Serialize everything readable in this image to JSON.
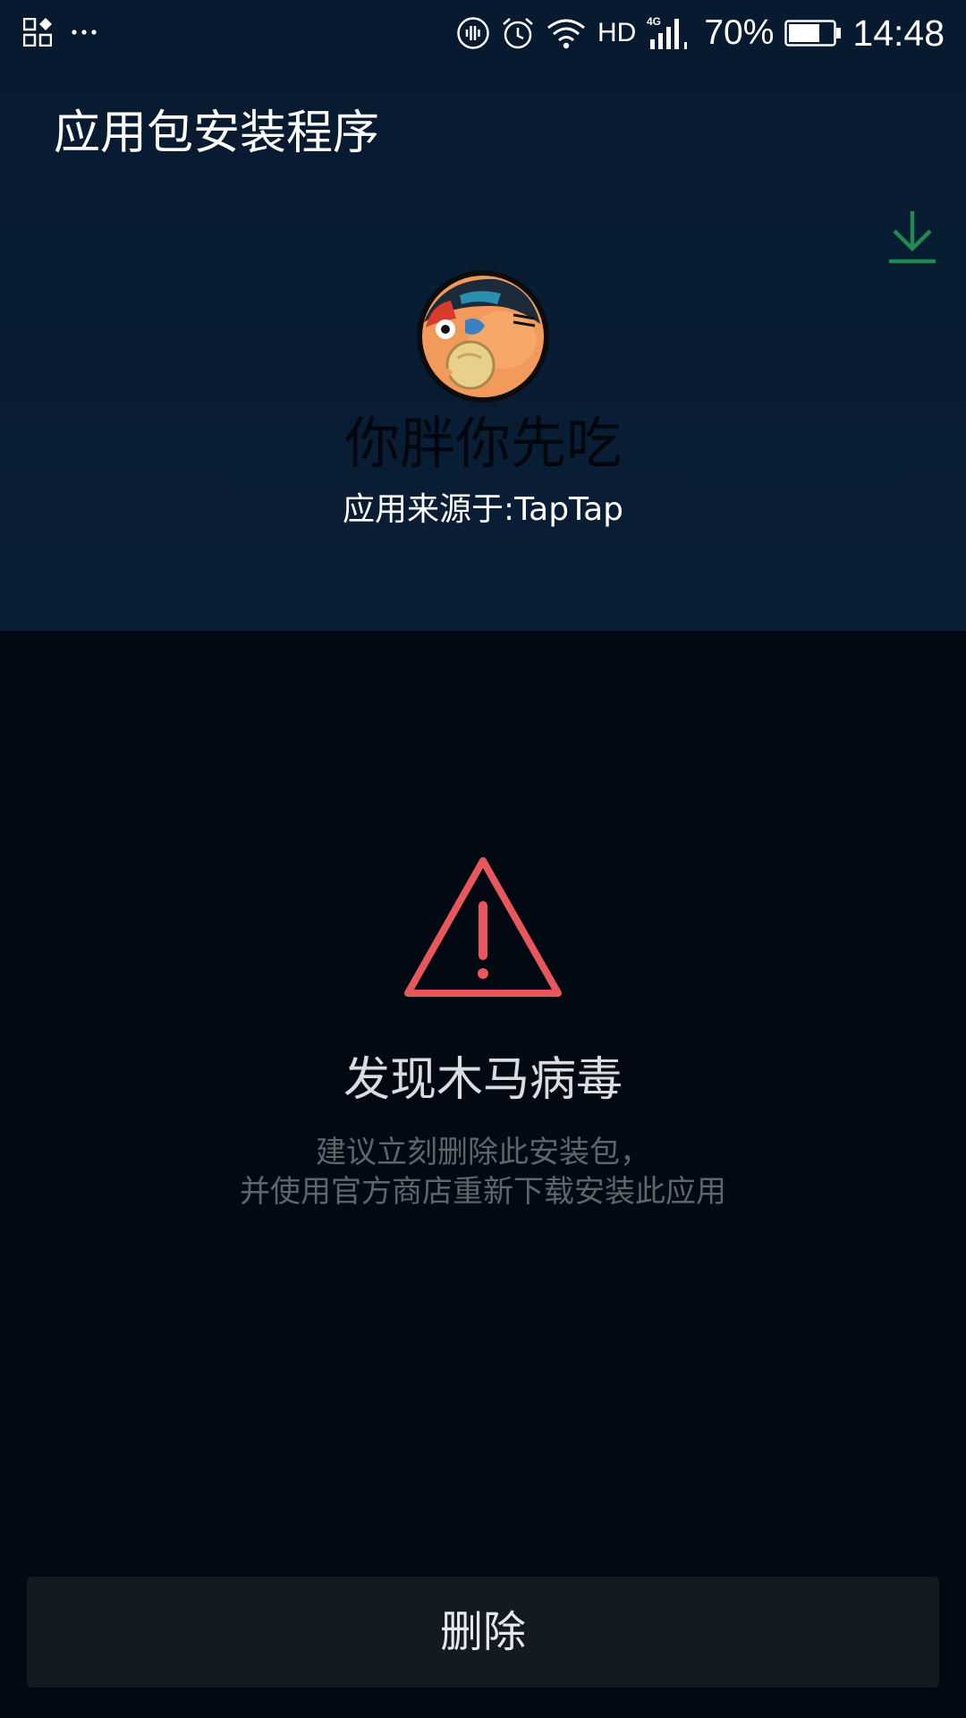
{
  "status_bar": {
    "left_icons": [
      "apps-grid-icon",
      "more-dots-icon"
    ],
    "right_icons": [
      "nfc-icon",
      "alarm-icon",
      "wifi-icon",
      "signal-4g-icon",
      "battery-icon"
    ],
    "network_label": "HD",
    "network_type": "4G",
    "battery_percent": "70%",
    "battery_level": 0.7,
    "time": "14:48"
  },
  "header": {
    "title": "应用包安装程序",
    "download_icon": "download-icon",
    "download_color": "#1f8a52"
  },
  "app": {
    "name": "你胖你先吃",
    "source": "应用来源于:TapTap",
    "icon": "app-avatar-icon"
  },
  "warning": {
    "icon": "warning-triangle-icon",
    "icon_color": "#e8575c",
    "title": "发现木马病毒",
    "description_lines": [
      "建议立刻删除此安装包，",
      "并使用官方商店重新下载安装此应用"
    ]
  },
  "actions": {
    "delete_label": "删除"
  },
  "colors": {
    "header_bg": "#0a1e36",
    "body_bg": "#020913",
    "button_bg": "#141a22"
  }
}
